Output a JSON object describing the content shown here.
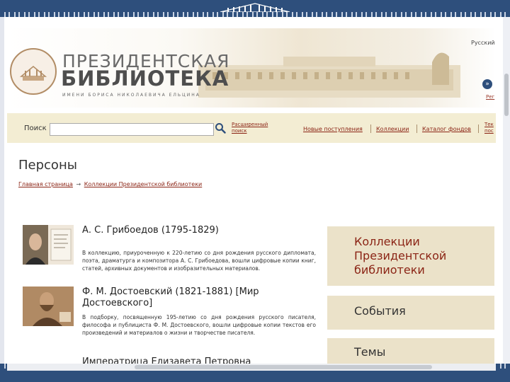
{
  "header": {
    "brand_line1": "ПРЕЗИДЕНТСКАЯ",
    "brand_line2": "БИБЛИОТЕКА",
    "brand_line3": "ИМЕНИ БОРИСА НИКОЛАЕВИЧА ЕЛЬЦИНА",
    "language": "Русский",
    "next_label": "»",
    "register_link": "Рег"
  },
  "nav": {
    "search_label": "Поиск",
    "search_value": "",
    "extended_search": "Расширенный поиск",
    "links": [
      "Новые поступления",
      "Коллекции",
      "Каталог фондов"
    ],
    "cut_link": "Тек пос"
  },
  "page": {
    "title": "Персоны",
    "breadcrumb": [
      "Главная страница",
      "Коллекции Президентской библиотеки"
    ],
    "breadcrumb_sep": "→"
  },
  "persons": [
    {
      "name": "А. С. Грибоедов (1795-1829)",
      "desc": "В коллекцию, приуроченную к 220-летию со дня рождения русского дипломата, поэта, драматурга и композитора А. С. Грибоедова, вошли цифровые копии книг, статей, архивных документов и изобразительных материалов."
    },
    {
      "name": "Ф. М. Достоевский (1821-1881) [Мир Достоевского]",
      "desc": "В подборку, посвященную 195-летию со дня рождения русского писателя, философа и публициста Ф. М. Достоевского, вошли цифровые копии текстов его произведений и материалов о жизни и творчестве писателя."
    },
    {
      "name": "Императрица Елизавета Петровна",
      "desc": ""
    }
  ],
  "sidebar": {
    "collections": "Коллекции Президентской библиотеки",
    "events": "События",
    "themes": "Темы"
  },
  "colors": {
    "brand_blue": "#2e4f7c",
    "link_red": "#8b2415",
    "nav_bg": "#f3edd3",
    "sidebar_bg": "#ebe2c9"
  }
}
